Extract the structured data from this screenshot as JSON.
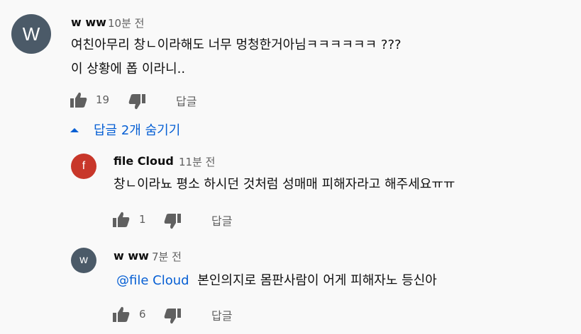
{
  "comment": {
    "avatar_letter": "W",
    "avatar_color": "#4b5a68",
    "author": "w ww",
    "time": "10분 전",
    "text_line1": "여친아무리 창ㄴ이라해도 너무 멍청한거아님ㅋㅋㅋㅋㅋㅋ ???",
    "text_line2": "이 상황에 폽 이라니..",
    "likes": "19",
    "reply_label": "답글"
  },
  "replies_toggle": {
    "label": "답글 2개 숨기기",
    "icon": "caret-up-icon",
    "color": "#065fd4"
  },
  "replies": [
    {
      "avatar_letter": "f",
      "avatar_color": "#c8372a",
      "author": "file Cloud",
      "time": "11분 전",
      "text": "창ㄴ이라뇨 평소 하시던 것처럼 성매매 피해자라고 해주세요ㅠㅠ",
      "likes": "1",
      "reply_label": "답글"
    },
    {
      "avatar_letter": "w",
      "avatar_color": "#4b5a68",
      "author": "w ww",
      "time": "7분 전",
      "mention": "@file Cloud",
      "text": "본인의지로 몸판사람이 어게 피해자노 등신아",
      "likes": "6",
      "reply_label": "답글"
    }
  ]
}
